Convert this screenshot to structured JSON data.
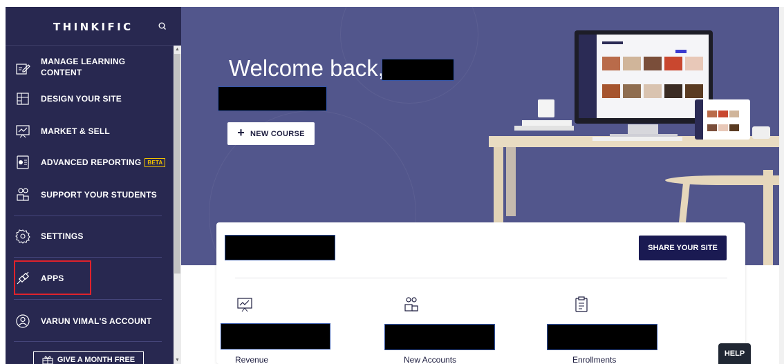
{
  "sidebar": {
    "logo": "THINKIFIC",
    "items": [
      {
        "label_line1": "MANAGE LEARNING",
        "label_line2": "CONTENT",
        "icon": "edit-content-icon"
      },
      {
        "label": "DESIGN YOUR SITE",
        "icon": "layout-icon"
      },
      {
        "label": "MARKET & SELL",
        "icon": "chart-board-icon"
      },
      {
        "label": "ADVANCED REPORTING",
        "badge": "BETA",
        "icon": "report-icon"
      },
      {
        "label": "SUPPORT YOUR STUDENTS",
        "icon": "students-icon"
      },
      {
        "label": "SETTINGS",
        "icon": "gear-icon"
      },
      {
        "label": "APPS",
        "icon": "plug-icon"
      },
      {
        "label": "VARUN VIMAL'S ACCOUNT",
        "icon": "user-icon"
      }
    ],
    "gift_button": "GIVE A MONTH FREE"
  },
  "hero": {
    "welcome": "Welcome back,",
    "new_course_button": "NEW COURSE"
  },
  "card": {
    "share_button": "SHARE YOUR SITE",
    "stats": [
      {
        "label": "Revenue",
        "icon": "chart-board-icon"
      },
      {
        "label": "New Accounts",
        "icon": "students-icon"
      },
      {
        "label": "Enrollments",
        "icon": "clipboard-icon"
      }
    ]
  },
  "help_button": "HELP",
  "colors": {
    "sidebar_bg": "#282850",
    "hero_bg": "#52568c",
    "primary_button": "#1a1a52",
    "highlight_box": "#e0222b",
    "beta_badge": "#f2c200"
  }
}
